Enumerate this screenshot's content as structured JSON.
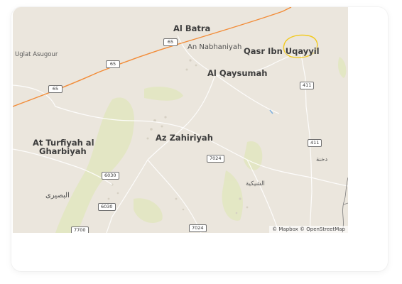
{
  "map": {
    "places": {
      "al_batra": "Al Batra",
      "an_nabhaniyah": "An Nabhaniyah",
      "qasr_ibn_uqayyil": "Qasr Ibn Uqayyil",
      "uglat_asugour": "Uglat Asugour",
      "al_qaysumah": "Al Qaysumah",
      "at_turfiyah_line1": "At Turfiyah al",
      "at_turfiyah_line2": "Gharbiyah",
      "az_zahiriyah": "Az Zahiriyah",
      "ash_shuqayyah": "الشيكية",
      "al_busayri": "البصيرى",
      "dakhnah": "دخنة"
    },
    "road_shields": {
      "r65_a": "65",
      "r65_b": "65",
      "r65_c": "65",
      "r411_a": "411",
      "r411_b": "411",
      "r7024_a": "7024",
      "r7024_b": "7024",
      "r6030_a": "6030",
      "r6030_b": "6030",
      "r7700": "7700"
    },
    "attribution": "© Mapbox © OpenStreetMap",
    "colors": {
      "land": "#ebe6dd",
      "vegetation": "#e3e6c4",
      "highway": "#f28c38",
      "minor_road": "#ffffff",
      "city_boundary": "#f2c919",
      "water": "#7fb2e0"
    }
  }
}
